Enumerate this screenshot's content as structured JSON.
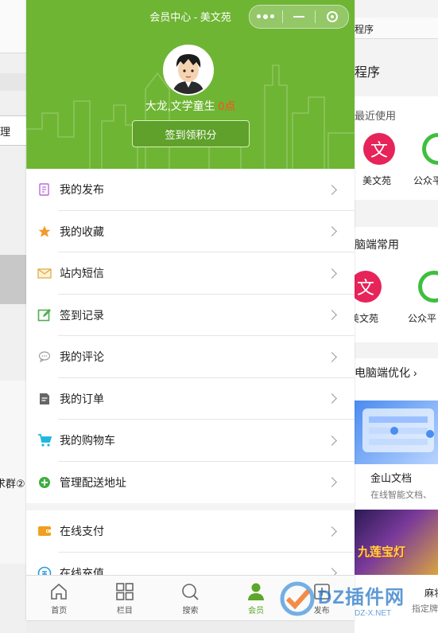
{
  "background_left": {
    "labels": [
      {
        "key": "manage",
        "text": "理"
      },
      {
        "key": "group",
        "text": "求群②"
      }
    ]
  },
  "background_right": {
    "top_label": "程序",
    "section_title": "程序",
    "recent_label": "最近使用",
    "recent_apps": [
      {
        "name": "美文苑",
        "glyph": "文"
      },
      {
        "name": "公众平"
      }
    ],
    "pc_label": "脑端常用",
    "pc_apps": [
      {
        "name": "美文苑",
        "glyph": "文"
      },
      {
        "name": "公众平"
      }
    ],
    "opt_label": "电脑端优化 ›",
    "wps_title": "金山文档",
    "wps_sub": "在线智能文档、",
    "game_text": "九莲宝灯",
    "game_title": "麻将",
    "game_sub": "指定牌"
  },
  "header": {
    "title": "会员中心 - 美文苑",
    "user_name": "大龙,文学童生",
    "points": "0点",
    "signin_button": "签到领积分"
  },
  "menu": [
    {
      "label": "我的发布",
      "icon": "post-icon",
      "color": "#b86ad9"
    },
    {
      "label": "我的收藏",
      "icon": "star-icon",
      "color": "#f39a2c"
    },
    {
      "label": "站内短信",
      "icon": "envelope-icon",
      "color": "#e0a63c"
    },
    {
      "label": "签到记录",
      "icon": "edit-icon",
      "color": "#4caf50"
    },
    {
      "label": "我的评论",
      "icon": "comment-icon",
      "color": "#9e9e9e"
    },
    {
      "label": "我的订单",
      "icon": "order-icon",
      "color": "#666666"
    },
    {
      "label": "我的购物车",
      "icon": "cart-icon",
      "color": "#1fb6e0"
    },
    {
      "label": "管理配送地址",
      "icon": "plus-circle-icon",
      "color": "#3fae3f"
    }
  ],
  "menu2": [
    {
      "label": "在线支付",
      "icon": "wallet-icon",
      "color": "#f0a020"
    },
    {
      "label": "在线充值",
      "icon": "recharge-icon",
      "color": "#2b9be0"
    }
  ],
  "tabs": [
    {
      "label": "首页",
      "icon": "home-icon"
    },
    {
      "label": "栏目",
      "icon": "grid-icon"
    },
    {
      "label": "搜索",
      "icon": "search-icon"
    },
    {
      "label": "会员",
      "icon": "user-icon",
      "active": true
    },
    {
      "label": "发布",
      "icon": "publish-icon"
    }
  ],
  "watermark": {
    "text": "DZ插件网",
    "sub": "DZ-X.NET"
  },
  "colors": {
    "brand_green": "#6fb534",
    "active_tab": "#5ca62a",
    "points_red": "#ff4b1f"
  }
}
